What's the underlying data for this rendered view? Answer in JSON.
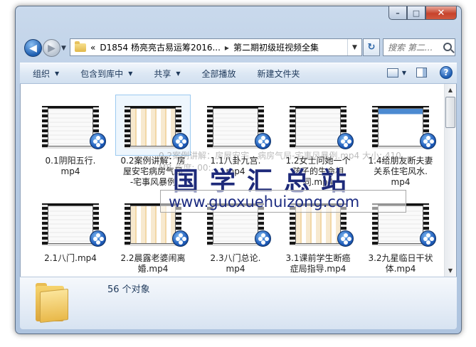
{
  "window": {
    "caption": {
      "min": "–",
      "max": "□",
      "close": "✕"
    }
  },
  "nav": {
    "back_icon": "arrow-left-icon",
    "forward_icon": "arrow-right-icon",
    "path_prefix": "«",
    "path": [
      "D1854 杨亮亮古易运筹2016...",
      "第二期初级班视频全集"
    ],
    "path_sep": "▸",
    "search_placeholder": "搜索 第二..."
  },
  "toolbar": {
    "organize": "组织",
    "include": "包含到库中",
    "share": "共享",
    "play_all": "全部播放",
    "new_folder": "新建文件夹"
  },
  "files": [
    {
      "name": "0.1阴阳五行.mp4",
      "thumb": "plain"
    },
    {
      "name": "0.2案例讲解：房屋安宅、病房气局-宅事风暴例",
      "thumb": "warm",
      "selected": true
    },
    {
      "name": "1.1八卦九宫.mp4",
      "thumb": "plain"
    },
    {
      "name": "1.2女士问她一个人孩子的生命相同.mp4",
      "thumb": "plain"
    },
    {
      "name": "1.4给朋友断夫妻关系住宅风水.mp4",
      "thumb": "blue"
    },
    {
      "name": "2.1八门.mp4",
      "thumb": "plain"
    },
    {
      "name": "2.2晨露老婆闹离婚.mp4",
      "thumb": "warm"
    },
    {
      "name": "2.3八门总论.mp4",
      "thumb": "plain"
    },
    {
      "name": "3.1课前学生断癌症局指导.mp4",
      "thumb": "warm"
    },
    {
      "name": "3.2九星临日干状体.mp4",
      "thumb": "plain"
    }
  ],
  "file_labels": [
    [
      "0.1阴阳五行.",
      "mp4"
    ],
    [
      "0.2案例讲解：房",
      "屋安宅病房气局",
      "-宅事风暴例"
    ],
    [
      "1.1八卦九宫.",
      "mp4"
    ],
    [
      "1.2女士问她一个",
      "孩子的生命相",
      "同.mp4"
    ],
    [
      "1.4给朋友断夫妻",
      "关系住宅风水.",
      "mp4"
    ],
    [
      "2.1八门.mp4"
    ],
    [
      "2.2晨露老婆闹离",
      "婚.mp4"
    ],
    [
      "2.3八门总论.",
      "mp4"
    ],
    [
      "3.1课前学生断癌",
      "症局指导.mp4"
    ],
    [
      "3.2九星临日干状",
      "体.mp4"
    ]
  ],
  "tooltip": "0.2案例讲解：房屋安宅、病房气局-宅事风暴例.mp4 大小: 410 MB 长度: 00:...",
  "watermark": {
    "title": "国学汇总站",
    "url": "www.guoxuehuizong.com"
  },
  "details": {
    "count": "56 个对象"
  },
  "colors": {
    "accent": "#1e395b",
    "close": "#c7432c"
  }
}
